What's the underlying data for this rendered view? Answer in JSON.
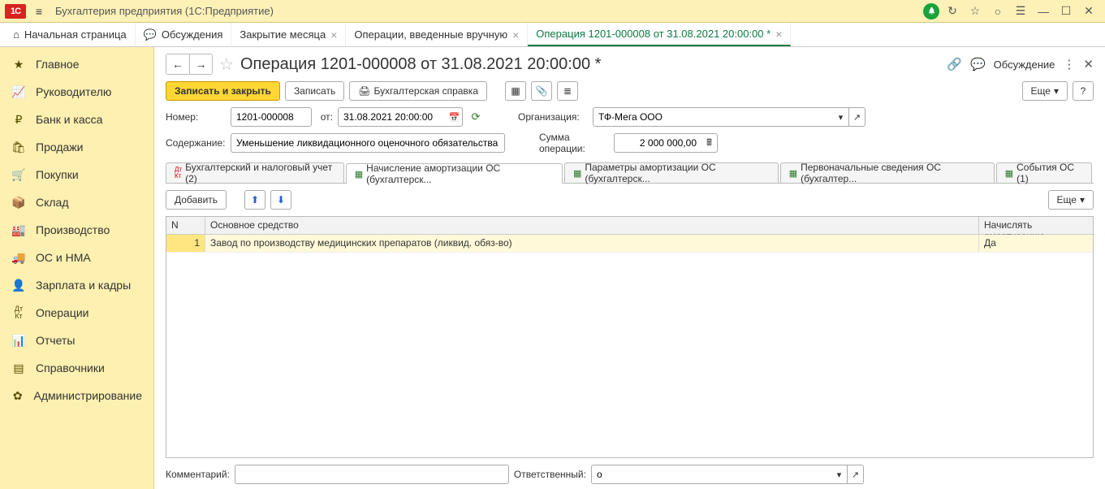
{
  "window": {
    "title": "Бухгалтерия предприятия  (1С:Предприятие)"
  },
  "tabs": [
    {
      "label": "Начальная страница"
    },
    {
      "label": "Обсуждения"
    },
    {
      "label": "Закрытие месяца"
    },
    {
      "label": "Операции, введенные вручную"
    },
    {
      "label": "Операция 1201-000008 от 31.08.2021 20:00:00 *"
    }
  ],
  "sidebar": {
    "items": [
      {
        "label": "Главное"
      },
      {
        "label": "Руководителю"
      },
      {
        "label": "Банк и касса"
      },
      {
        "label": "Продажи"
      },
      {
        "label": "Покупки"
      },
      {
        "label": "Склад"
      },
      {
        "label": "Производство"
      },
      {
        "label": "ОС и НМА"
      },
      {
        "label": "Зарплата и кадры"
      },
      {
        "label": "Операции"
      },
      {
        "label": "Отчеты"
      },
      {
        "label": "Справочники"
      },
      {
        "label": "Администрирование"
      }
    ]
  },
  "page": {
    "title": "Операция 1201-000008 от 31.08.2021 20:00:00 *",
    "discuss": "Обсуждение"
  },
  "toolbar": {
    "saveClose": "Записать и закрыть",
    "save": "Записать",
    "print": "Бухгалтерская справка",
    "more": "Еще"
  },
  "form": {
    "numberLabel": "Номер:",
    "number": "1201-000008",
    "fromLabel": "от:",
    "date": "31.08.2021 20:00:00",
    "orgLabel": "Организация:",
    "org": "ТФ-Мега ООО",
    "contentLabel": "Содержание:",
    "content": "Уменьшение ликвидационного оценочного обязательства",
    "sumLabel": "Сумма операции:",
    "sum": "2 000 000,00"
  },
  "subtabs": {
    "t0": "Бухгалтерский и налоговый учет (2)",
    "t1": "Начисление амортизации ОС (бухгалтерск...",
    "t2": "Параметры амортизации ОС (бухгалтерск...",
    "t3": "Первоначальные сведения ОС (бухгалтер...",
    "t4": "События ОС (1)"
  },
  "tblToolbar": {
    "add": "Добавить",
    "more": "Еще"
  },
  "table": {
    "head": {
      "n": "N",
      "main": "Основное средство",
      "amort": "Начислять амортизацию"
    },
    "rows": [
      {
        "n": "1",
        "main": "Завод по производству медицинских препаратов (ликвид. обяз-во)",
        "amort": "Да"
      }
    ]
  },
  "footer": {
    "commentLabel": "Комментарий:",
    "comment": "",
    "respLabel": "Ответственный:",
    "resp": "о"
  }
}
